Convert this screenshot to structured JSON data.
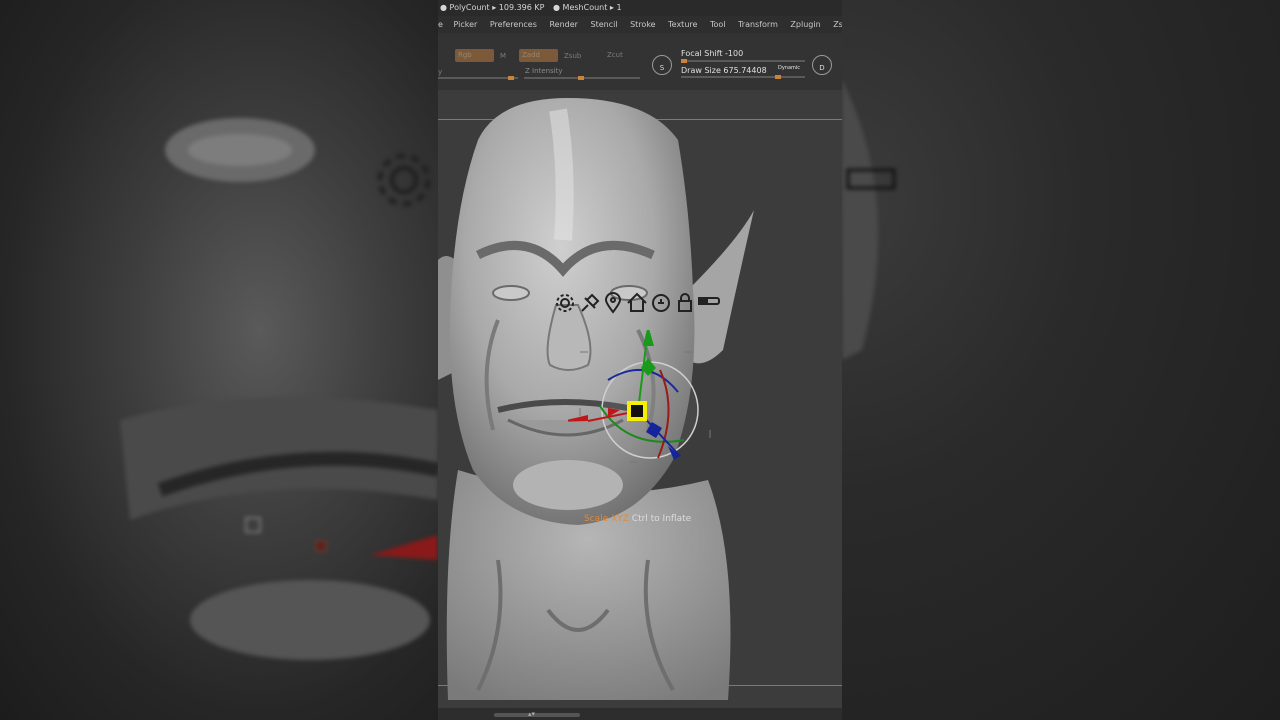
{
  "status_bar": {
    "polycount": "● PolyCount ▸ 109.396 KP",
    "meshcount": "● MeshCount ▸ 1"
  },
  "menu": {
    "items": [
      "e",
      "Picker",
      "Preferences",
      "Render",
      "Stencil",
      "Stroke",
      "Texture",
      "Tool",
      "Transform",
      "Zplugin",
      "Zscript"
    ]
  },
  "toolbar": {
    "rgb_label": "Rgb",
    "m_label": "M",
    "zadd_label": "Zadd",
    "zsub_label": "Zsub",
    "zcut_label": "Zcut",
    "z_intensity_label": "Z Intensity",
    "focal_shift_label": "Focal Shift",
    "focal_shift_value": "-100",
    "draw_size_label": "Draw Size",
    "draw_size_value": "675.74408",
    "dynamic_label": "Dynamic",
    "s_label": "S",
    "d_label": "D"
  },
  "gizmo_icons": [
    "gear-icon",
    "pin-icon",
    "location-icon",
    "home-icon",
    "reset-icon",
    "lock-icon",
    "toggle-icon"
  ],
  "tooltip": {
    "action": "Scale XYZ",
    "hint": "Ctrl to Inflate"
  },
  "colors": {
    "accent_orange": "#e08a3c",
    "axis_x": "#c0161a",
    "axis_y": "#1a9a1a",
    "axis_z": "#14249a",
    "handle_yellow": "#f6f000"
  }
}
